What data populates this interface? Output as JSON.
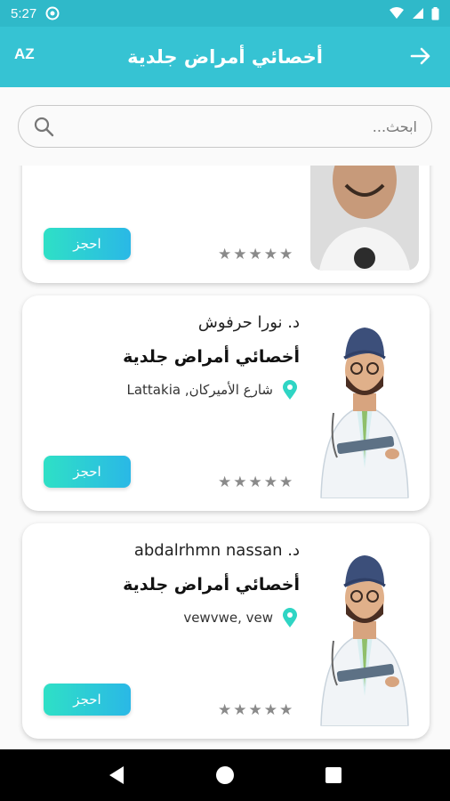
{
  "status": {
    "time": "5:27"
  },
  "app_bar": {
    "title": "أخصائي أمراض جلدية",
    "sort_label": "AZ"
  },
  "search": {
    "placeholder": "ابحث..."
  },
  "doctors": [
    {
      "name": "",
      "specialty": "",
      "location": "",
      "rating": 0,
      "book_label": "احجز",
      "avatar": "photo"
    },
    {
      "name": "د. نورا حرفوش",
      "specialty": "أخصائي أمراض جلدية",
      "location": "شارع الأميركان, Lattakia",
      "rating": 0,
      "book_label": "احجز",
      "avatar": "doctor-illustration"
    },
    {
      "name": "د. abdalrhmn nassan",
      "specialty": "أخصائي أمراض جلدية",
      "location": "vewvwe, vew",
      "rating": 0,
      "book_label": "احجز",
      "avatar": "doctor-illustration"
    }
  ],
  "colors": {
    "accent": "#36c3d3",
    "status": "#2fb9c9",
    "pin": "#2fd5c4"
  }
}
